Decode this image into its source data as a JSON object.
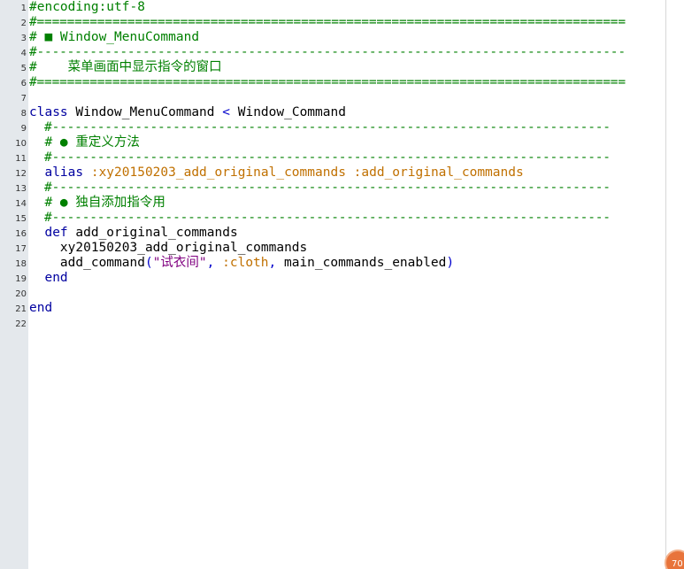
{
  "editor": {
    "lines": [
      {
        "n": "1",
        "parts": [
          {
            "t": "#encoding:utf-8",
            "c": "comment"
          }
        ]
      },
      {
        "n": "2",
        "parts": [
          {
            "t": "#==============================================================================",
            "c": "sep"
          }
        ]
      },
      {
        "n": "3",
        "parts": [
          {
            "t": "# ■ Window_MenuCommand",
            "c": "comment"
          }
        ]
      },
      {
        "n": "4",
        "parts": [
          {
            "t": "#------------------------------------------------------------------------------",
            "c": "sep"
          }
        ]
      },
      {
        "n": "5",
        "parts": [
          {
            "t": "#    菜单画面中显示指令的窗口",
            "c": "comment"
          }
        ]
      },
      {
        "n": "6",
        "parts": [
          {
            "t": "#==============================================================================",
            "c": "sep"
          }
        ]
      },
      {
        "n": "7",
        "parts": []
      },
      {
        "n": "8",
        "parts": [
          {
            "t": "class",
            "c": "kw"
          },
          {
            "t": " Window_MenuCommand ",
            "c": "id"
          },
          {
            "t": "<",
            "c": "op"
          },
          {
            "t": " Window_Command",
            "c": "id"
          }
        ]
      },
      {
        "n": "9",
        "parts": [
          {
            "t": "  #--------------------------------------------------------------------------",
            "c": "sep"
          }
        ]
      },
      {
        "n": "10",
        "parts": [
          {
            "t": "  # ● 重定义方法",
            "c": "comment"
          }
        ]
      },
      {
        "n": "11",
        "parts": [
          {
            "t": "  #--------------------------------------------------------------------------",
            "c": "sep"
          }
        ]
      },
      {
        "n": "12",
        "parts": [
          {
            "t": "  alias",
            "c": "kw"
          },
          {
            "t": " :xy20150203_add_original_commands :add_original_commands",
            "c": "sym"
          }
        ]
      },
      {
        "n": "13",
        "parts": [
          {
            "t": "  #--------------------------------------------------------------------------",
            "c": "sep"
          }
        ]
      },
      {
        "n": "14",
        "parts": [
          {
            "t": "  # ● 独自添加指令用",
            "c": "comment"
          }
        ]
      },
      {
        "n": "15",
        "parts": [
          {
            "t": "  #--------------------------------------------------------------------------",
            "c": "sep"
          }
        ]
      },
      {
        "n": "16",
        "parts": [
          {
            "t": "  def",
            "c": "kw"
          },
          {
            "t": " add_original_commands",
            "c": "id"
          }
        ]
      },
      {
        "n": "17",
        "parts": [
          {
            "t": "    xy20150203_add_original_commands",
            "c": "id"
          }
        ]
      },
      {
        "n": "18",
        "parts": [
          {
            "t": "    add_command",
            "c": "id"
          },
          {
            "t": "(",
            "c": "op"
          },
          {
            "t": "\"试衣间\"",
            "c": "str"
          },
          {
            "t": ", ",
            "c": "op"
          },
          {
            "t": ":cloth",
            "c": "sym"
          },
          {
            "t": ", ",
            "c": "op"
          },
          {
            "t": "main_commands_enabled",
            "c": "id"
          },
          {
            "t": ")",
            "c": "op"
          }
        ]
      },
      {
        "n": "19",
        "parts": [
          {
            "t": "  end",
            "c": "kw"
          }
        ]
      },
      {
        "n": "20",
        "parts": []
      },
      {
        "n": "21",
        "parts": [
          {
            "t": "end",
            "c": "kw"
          }
        ]
      },
      {
        "n": "22",
        "parts": []
      }
    ]
  },
  "status": {
    "zoom_badge": "70"
  },
  "colors": {
    "comment": "#008000",
    "keyword": "#0000a0",
    "symbol": "#c07000",
    "string": "#800080",
    "gutter": "#e4e8ec",
    "badge": "#e8743b"
  }
}
